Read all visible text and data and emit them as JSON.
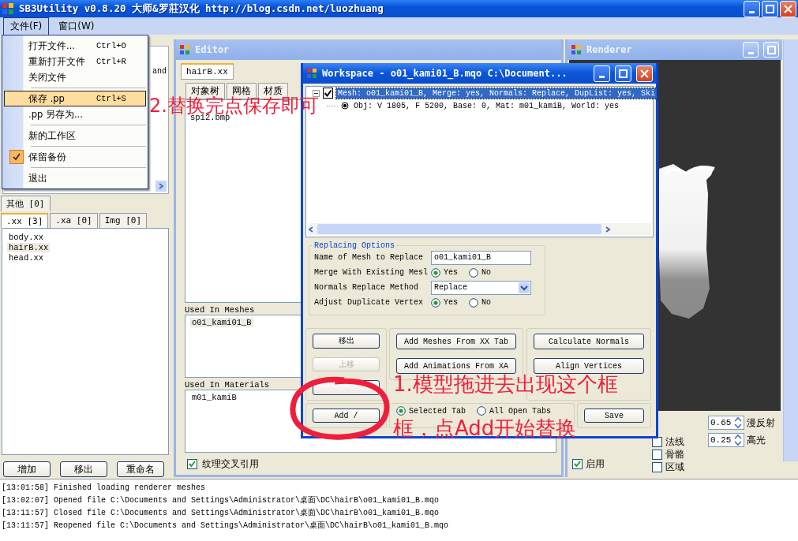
{
  "window": {
    "title": "SB3Utility v0.8.20  大师&罗莊汉化  http://blog.csdn.net/luozhuang",
    "menu": [
      {
        "label": "文件(F)",
        "selected": true
      },
      {
        "label": "窗口(W)",
        "selected": false
      }
    ]
  },
  "file_menu": [
    {
      "kind": "item",
      "label": "打开文件...",
      "shortcut": "Ctrl+O",
      "highlighted": false,
      "checked": false
    },
    {
      "kind": "item",
      "label": "重新打开文件",
      "shortcut": "Ctrl+R",
      "highlighted": false,
      "checked": false
    },
    {
      "kind": "item",
      "label": "关闭文件",
      "highlighted": false,
      "checked": false
    },
    {
      "kind": "separator"
    },
    {
      "kind": "item",
      "label": "保存 .pp",
      "shortcut": "Ctrl+S",
      "highlighted": true,
      "checked": false
    },
    {
      "kind": "item",
      "label": ".pp 另存为...",
      "highlighted": false,
      "checked": false
    },
    {
      "kind": "separator"
    },
    {
      "kind": "item",
      "label": "新的工作区",
      "highlighted": false,
      "checked": false
    },
    {
      "kind": "separator"
    },
    {
      "kind": "item",
      "label": "保留备份",
      "highlighted": false,
      "checked": true
    },
    {
      "kind": "separator"
    },
    {
      "kind": "item",
      "label": "退出",
      "highlighted": false,
      "checked": false
    }
  ],
  "left_panel": {
    "fragment": "and",
    "tabs_top": [
      {
        "label": "其他 [0]",
        "selected": false
      }
    ],
    "tabs": [
      {
        "label": ".xx [3]",
        "selected": true
      },
      {
        "label": ".xa [0]",
        "selected": false
      },
      {
        "label": "Img [0]",
        "selected": false
      }
    ],
    "files": [
      {
        "name": "body.xx",
        "selected": false
      },
      {
        "name": "hairB.xx",
        "selected": true
      },
      {
        "name": "head.xx",
        "selected": false
      }
    ],
    "buttons": [
      "增加",
      "移出",
      "重命名"
    ]
  },
  "editor": {
    "title": "Editor",
    "file_tab": "hairB.xx",
    "subtabs": [
      "对象树",
      "网格",
      "材质"
    ],
    "textures": [
      "sp12.bmp"
    ],
    "used_in_meshes": {
      "label": "Used In Meshes",
      "items": [
        "o01_kami01_B"
      ]
    },
    "used_in_materials": {
      "label": "Used In Materials",
      "items": [
        "m01_kamiB"
      ]
    },
    "cross_ref": {
      "label": "纹理交叉引用",
      "checked": true
    }
  },
  "workspace": {
    "title": "Workspace - o01_kami01_B.mqo  C:\\Document...",
    "tree": [
      {
        "label": "Mesh: o01_kami01_B, Merge: yes, Normals: Replace, DupList: yes, Ski",
        "checked": true,
        "selected": true,
        "expanded": true,
        "children": [
          {
            "label": "Obj: V 1805, F 5200, Base: 0, Mat: m01_kamiB, World: yes"
          }
        ]
      }
    ],
    "options": {
      "title": "Replacing Options",
      "rows": [
        {
          "kind": "text",
          "label": "Name of Mesh to Replace",
          "value": "o01_kami01_B"
        },
        {
          "kind": "radio",
          "label": "Merge With Existing Mesl",
          "choices": [
            {
              "label": "Yes",
              "selected": true
            },
            {
              "label": "No",
              "selected": false
            }
          ]
        },
        {
          "kind": "select",
          "label": "Normals Replace Method",
          "value": "Replace"
        },
        {
          "kind": "radio",
          "label": "Adjust Duplicate Vertex",
          "choices": [
            {
              "label": "Yes",
              "selected": true
            },
            {
              "label": "No",
              "selected": false
            }
          ]
        }
      ]
    },
    "left_buttons": [
      {
        "label": "移出",
        "disabled": false
      },
      {
        "label": "上移",
        "disabled": true
      }
    ],
    "mid_buttons": [
      "Add Meshes From XX Tab",
      "Add Animations From XA"
    ],
    "right_buttons": [
      "Calculate Normals",
      "Align Vertices"
    ],
    "add_button": "Add /",
    "scope": [
      {
        "label": "Selected Tab",
        "selected": true
      },
      {
        "label": "All Open Tabs",
        "selected": false
      }
    ],
    "save_button": "Save"
  },
  "renderer": {
    "title": "Renderer",
    "checkboxes": [
      {
        "label": "法线",
        "checked": false
      },
      {
        "label": "骨骼",
        "checked": false
      },
      {
        "label": "区域",
        "checked": false
      }
    ],
    "enable": {
      "label": "启用",
      "checked": true
    },
    "spinners": [
      {
        "value": "0.65",
        "label": "漫反射"
      },
      {
        "value": "0.25",
        "label": "高光"
      }
    ]
  },
  "log": [
    "[13:01:58] Finished loading renderer meshes",
    "[13:02:07] Opened file C:\\Documents and Settings\\Administrator\\桌面\\DC\\hairB\\o01_kami01_B.mqo",
    "[13:11:57] Closed file C:\\Documents and Settings\\Administrator\\桌面\\DC\\hairB\\o01_kami01_B.mqo",
    "[13:11:57] Reopened file C:\\Documents and Settings\\Administrator\\桌面\\DC\\hairB\\o01_kami01_B.mqo"
  ],
  "annotations": [
    "2.替换完点保存即可",
    "1.模型拖进去出现这个框",
    "框，点Add开始替换"
  ]
}
